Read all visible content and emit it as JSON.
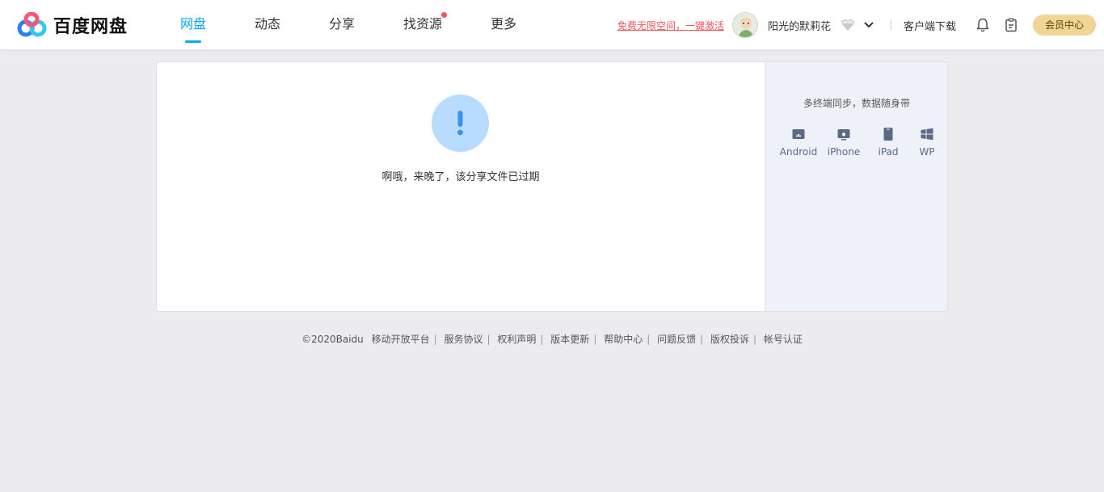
{
  "header": {
    "logo_text": "百度网盘",
    "nav": [
      {
        "label": "网盘",
        "active": true
      },
      {
        "label": "动态",
        "active": false
      },
      {
        "label": "分享",
        "active": false
      },
      {
        "label": "找资源",
        "active": false,
        "has_dot": true
      },
      {
        "label": "更多",
        "active": false
      }
    ],
    "promo_text": "免费无限空间，一键激活",
    "username": "阳光的默莉花",
    "download_label": "客户端下载",
    "vip_center_label": "会员中心"
  },
  "main": {
    "expired_message": "啊哦，来晚了，该分享文件已过期"
  },
  "sidebar": {
    "title": "多终端同步，数据随身带",
    "platforms": [
      {
        "label": "Android",
        "icon": "android-icon"
      },
      {
        "label": "iPhone",
        "icon": "iphone-icon"
      },
      {
        "label": "iPad",
        "icon": "ipad-icon"
      },
      {
        "label": "WP",
        "icon": "windows-phone-icon"
      }
    ]
  },
  "footer": {
    "copyright": "©2020Baidu",
    "links": [
      "移动开放平台",
      "服务协议",
      "权利声明",
      "版本更新",
      "帮助中心",
      "问题反馈",
      "版权投诉",
      "帐号认证"
    ]
  },
  "colors": {
    "accent": "#06a7ff",
    "promo_red": "#f5565b",
    "vip_gold": "#f0d594",
    "page_bg": "#ececef",
    "alert_circle": "#b7dcff",
    "alert_mark": "#3d8ff0"
  }
}
